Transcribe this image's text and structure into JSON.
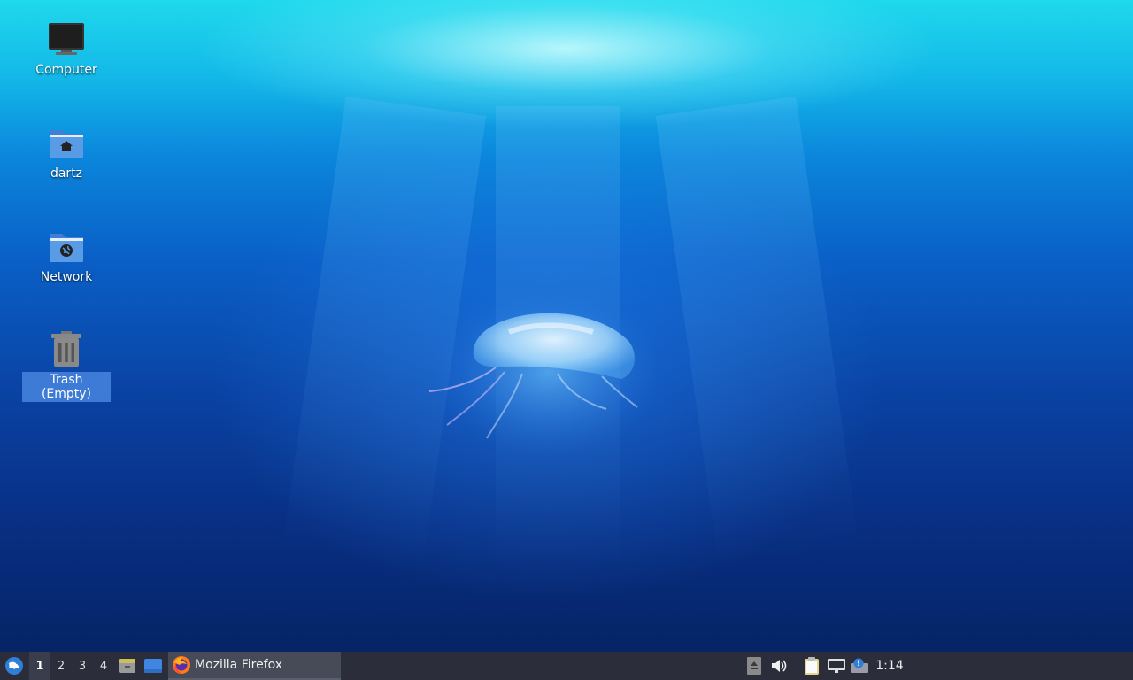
{
  "desktop": {
    "icons": [
      {
        "label": "Computer",
        "icon": "computer-icon"
      },
      {
        "label": "dartz",
        "icon": "home-folder-icon"
      },
      {
        "label": "Network",
        "icon": "network-folder-icon"
      },
      {
        "label": "Trash (Empty)",
        "icon": "trash-icon",
        "selected": true
      }
    ]
  },
  "taskbar": {
    "menu_icon": "app-menu-icon",
    "workspaces": [
      "1",
      "2",
      "3",
      "4"
    ],
    "active_workspace": "1",
    "launchers": [
      "file-manager-icon",
      "show-desktop-icon"
    ],
    "tasks": [
      {
        "label": "Mozilla Firefox",
        "icon": "firefox-icon"
      }
    ],
    "tray_icons": [
      "eject-icon",
      "volume-icon",
      "clipboard-icon",
      "network-icon",
      "update-notifier-icon"
    ],
    "clock": "1:14"
  },
  "colors": {
    "taskbar_bg": "#2b2e3a",
    "selection": "#3d7bd6"
  }
}
